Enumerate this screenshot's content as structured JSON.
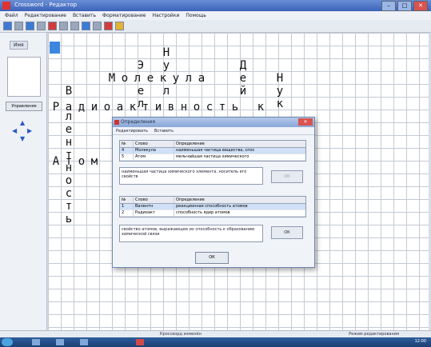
{
  "window": {
    "title": "Crossword - Редактор"
  },
  "menu": [
    "Файл",
    "Редактирование",
    "Вставить",
    "Форматирование",
    "Настройки",
    "Помощь"
  ],
  "left_panel": {
    "label": "Имя",
    "button": "Управление"
  },
  "crossword": {
    "row_radioactivity": [
      "Р",
      "а",
      "д",
      "и",
      "о",
      "а",
      "к",
      "т",
      "и",
      "в",
      "н",
      "о",
      "с",
      "т",
      "ь",
      "",
      "к"
    ],
    "row_molecule": [
      "М",
      "о",
      "л",
      "е",
      "к",
      "у",
      "л",
      "а"
    ],
    "row_atom": [
      "А",
      "т",
      "о",
      "м"
    ],
    "col_valence": [
      "В",
      "",
      "л",
      "е",
      "н",
      "т",
      "н",
      "о",
      "с",
      "т",
      "ь"
    ],
    "col_e": [
      "Э",
      "",
      "е",
      "л"
    ],
    "col_n": [
      "Н",
      "у",
      "",
      "л"
    ],
    "col_d": [
      "Д",
      "е",
      "й"
    ],
    "col_n2": [
      "Н",
      "у",
      "к"
    ]
  },
  "dialog": {
    "title": "Определения",
    "menu": [
      "Редактировать",
      "Вставить"
    ],
    "table1": {
      "headers": [
        "№",
        "Слово",
        "Определение"
      ],
      "rows": [
        [
          "4",
          "Молекула",
          "наименьшая частица вещества, спос"
        ],
        [
          "5",
          "Атом",
          "мельчайшая частица химического"
        ]
      ]
    },
    "desc1": "наименьшая частица химического элемента, носитель его свойств",
    "btn1": "ОК",
    "table2": {
      "headers": [
        "№",
        "Слово",
        "Определение"
      ],
      "rows": [
        [
          "1",
          "Валентн",
          "реакционная способность атомов"
        ],
        [
          "2",
          "Радиоакт",
          "способность ядер атомов"
        ]
      ]
    },
    "desc2": "свойство атомов, выражающее их способность к образованию химической связи",
    "btn2": "ОК",
    "ok": "ОК"
  },
  "statusbar": {
    "left": "Кроссворд изменён",
    "right": "Режим редактирования"
  },
  "taskbar": {
    "clock": "12:00"
  }
}
